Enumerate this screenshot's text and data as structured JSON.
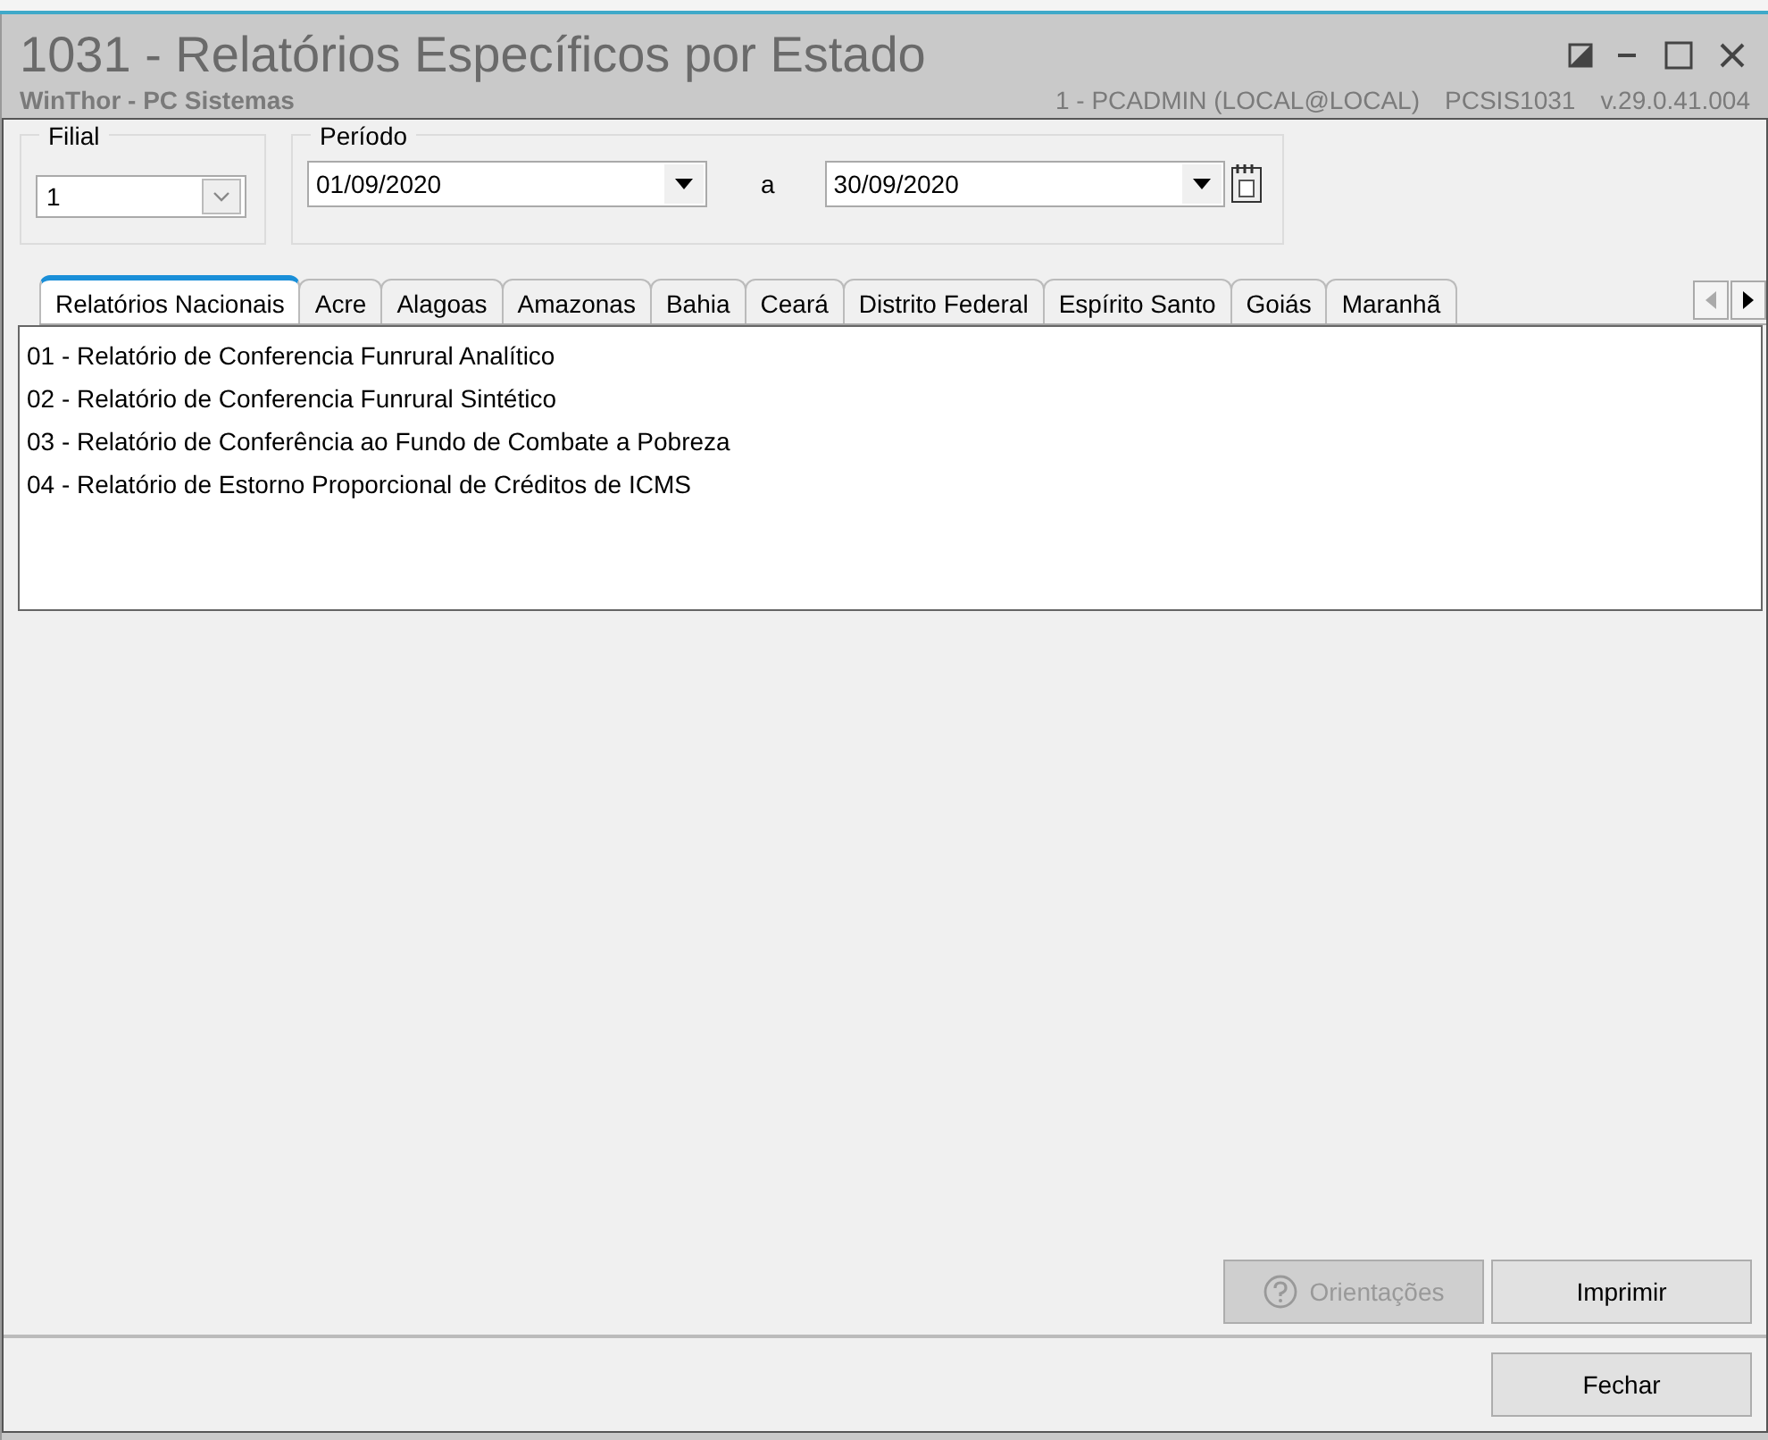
{
  "window": {
    "title": "1031 - Relatórios Específicos por Estado",
    "subtitle": "WinThor - PC Sistemas",
    "user": "1 - PCADMIN (LOCAL@LOCAL)",
    "routine": "PCSIS1031",
    "version": "v.29.0.41.004"
  },
  "filial": {
    "label": "Filial",
    "value": "1"
  },
  "periodo": {
    "label": "Período",
    "start": "01/09/2020",
    "separator": "a",
    "end": "30/09/2020"
  },
  "tabs": [
    {
      "label": "Relatórios Nacionais",
      "selected": true
    },
    {
      "label": "Acre",
      "selected": false
    },
    {
      "label": "Alagoas",
      "selected": false
    },
    {
      "label": "Amazonas",
      "selected": false
    },
    {
      "label": "Bahia",
      "selected": false
    },
    {
      "label": "Ceará",
      "selected": false
    },
    {
      "label": "Distrito Federal",
      "selected": false
    },
    {
      "label": "Espírito Santo",
      "selected": false
    },
    {
      "label": "Goiás",
      "selected": false
    },
    {
      "label": "Maranhã",
      "selected": false
    }
  ],
  "reports": [
    "01 - Relatório de Conferencia Funrural Analítico",
    "02 - Relatório de Conferencia Funrural Sintético",
    "03 - Relatório de Conferência ao Fundo de Combate a Pobreza",
    "04 - Relatório de Estorno Proporcional de Créditos de ICMS"
  ],
  "buttons": [
    {
      "label": "Orientações",
      "disabled": true,
      "kind": "help"
    },
    {
      "label": "Imprimir",
      "disabled": false,
      "kind": "plain"
    }
  ],
  "footer_button": {
    "label": "Fechar"
  }
}
